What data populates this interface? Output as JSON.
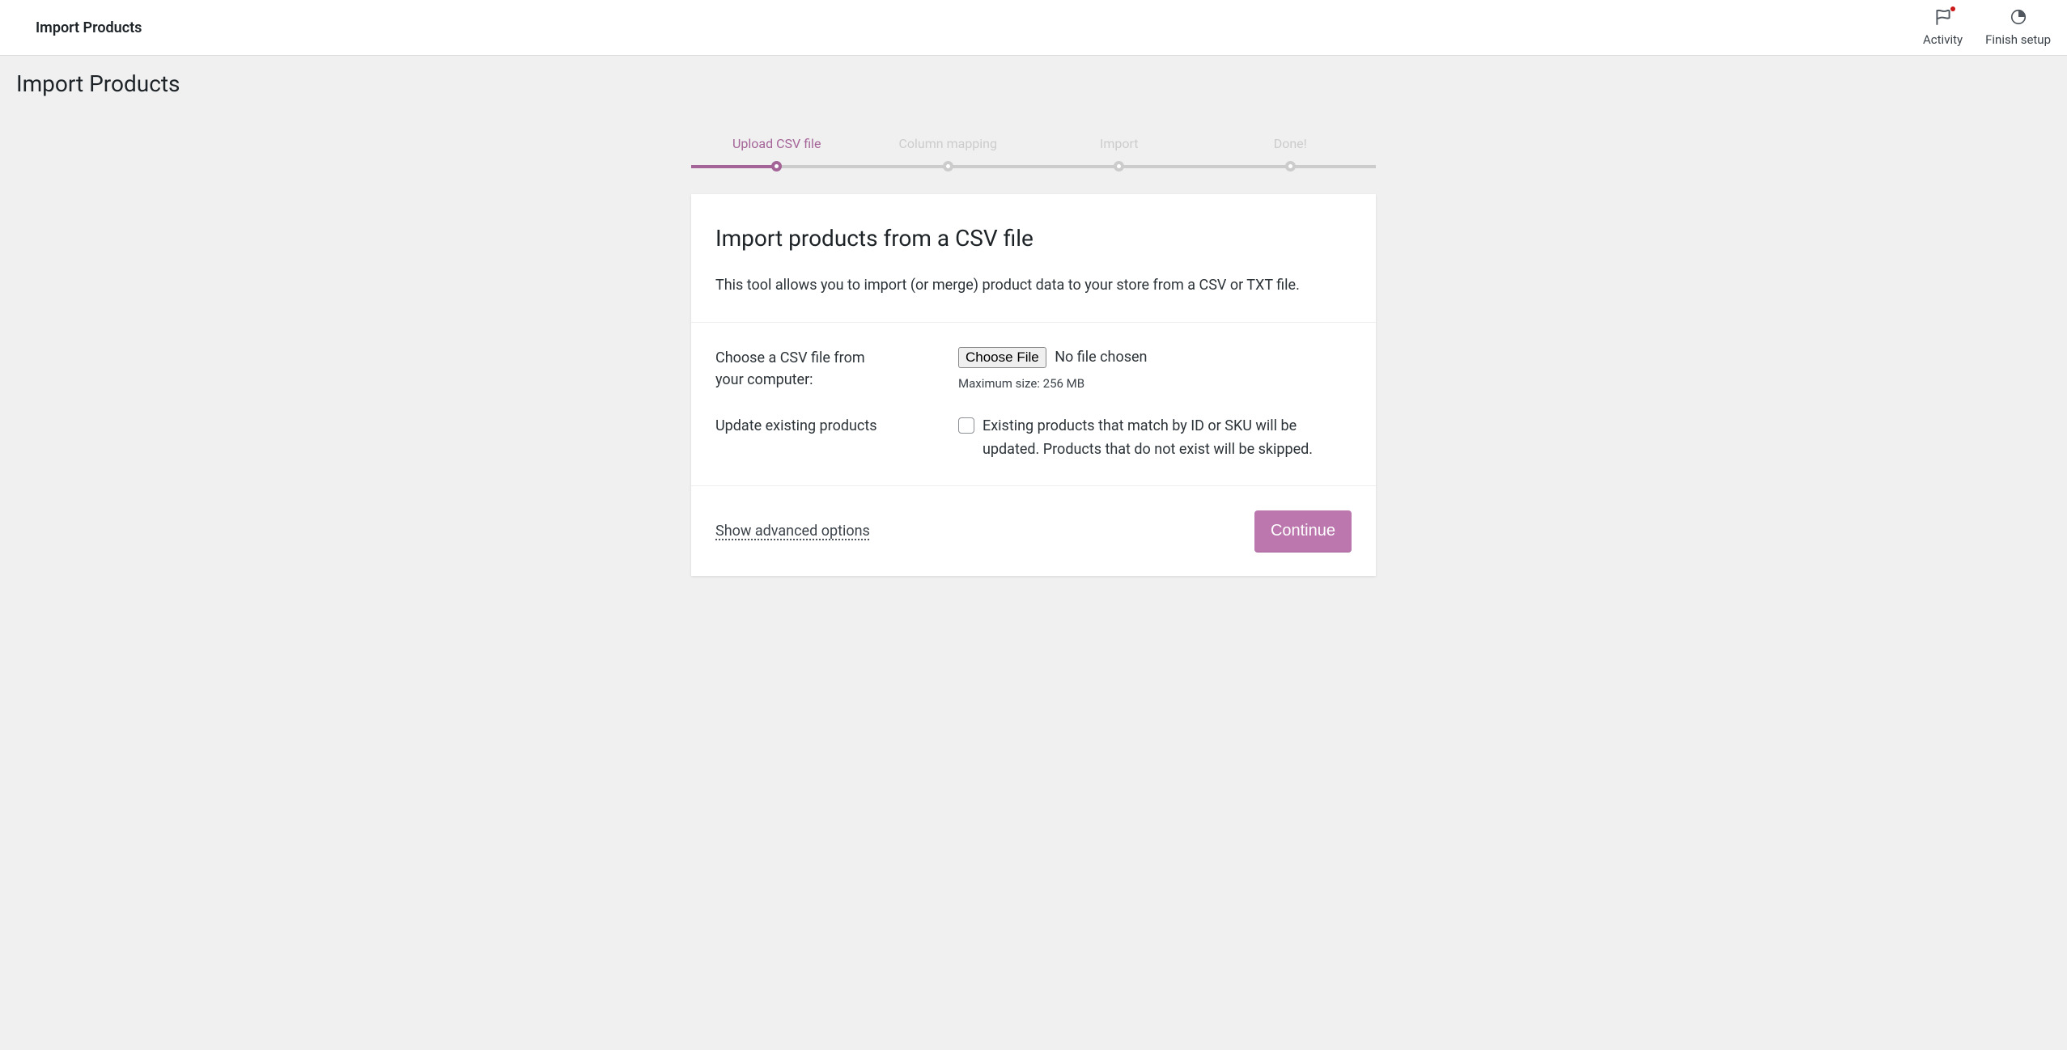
{
  "topbar": {
    "title": "Import Products",
    "actions": {
      "activity": "Activity",
      "finish_setup": "Finish setup"
    }
  },
  "page": {
    "heading": "Import Products"
  },
  "steps": [
    {
      "label": "Upload CSV file",
      "active": true
    },
    {
      "label": "Column mapping",
      "active": false
    },
    {
      "label": "Import",
      "active": false
    },
    {
      "label": "Done!",
      "active": false
    }
  ],
  "card": {
    "title": "Import products from a CSV file",
    "description": "This tool allows you to import (or merge) product data to your store from a CSV or TXT file."
  },
  "form": {
    "choose_file_label": "Choose a CSV file from your computer:",
    "choose_file_button": "Choose File",
    "no_file_chosen": "No file chosen",
    "max_size": "Maximum size: 256 MB",
    "update_label": "Update existing products",
    "update_description": "Existing products that match by ID or SKU will be updated. Products that do not exist will be skipped."
  },
  "footer": {
    "advanced_link": "Show advanced options",
    "continue": "Continue"
  }
}
